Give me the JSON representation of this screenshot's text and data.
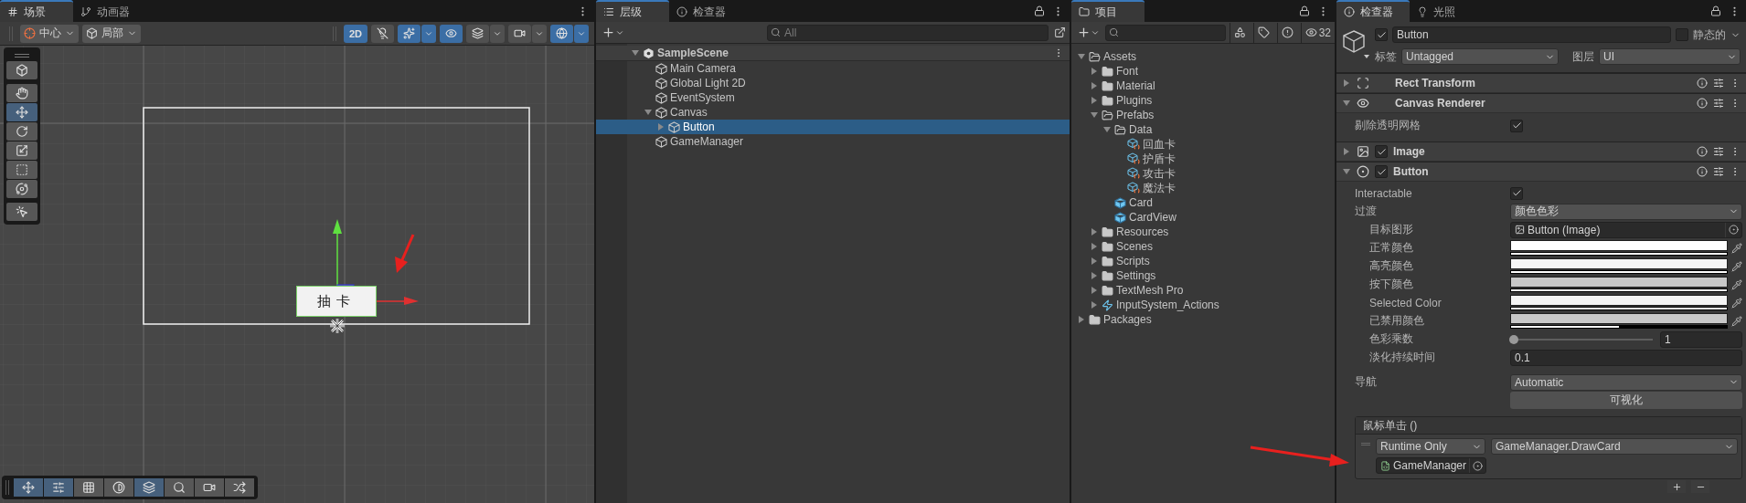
{
  "scene_panel": {
    "tabs": [
      {
        "label": "场景",
        "kind": "scene",
        "selected": true
      },
      {
        "label": "动画器",
        "kind": "animator",
        "selected": false
      }
    ],
    "toolbar": {
      "pivot": "中心",
      "space": "局部",
      "toggles": [
        {
          "kind": "mode",
          "label": "2D",
          "on": true
        },
        {
          "kind": "light",
          "on": false
        },
        {
          "kind": "fx",
          "on": true
        },
        {
          "kind": "visibility",
          "on": true
        },
        {
          "kind": "layers",
          "on": false
        },
        {
          "kind": "camera",
          "on": false
        },
        {
          "kind": "gizmos",
          "on": true
        }
      ]
    },
    "tools": [
      {
        "kind": "view",
        "selected": false
      },
      {
        "kind": "hand",
        "selected": false
      },
      {
        "kind": "move",
        "selected": true
      },
      {
        "kind": "rotate",
        "selected": false
      },
      {
        "kind": "scale",
        "selected": false
      },
      {
        "kind": "rect",
        "selected": false
      },
      {
        "kind": "transform",
        "selected": false
      },
      {
        "kind": "add",
        "selected": false
      }
    ],
    "game_button_label": "抽卡",
    "overlay_tools": [
      {
        "kind": "move",
        "on": true
      },
      {
        "kind": "snap",
        "on": true
      },
      {
        "kind": "grid",
        "on": false
      },
      {
        "kind": "shading",
        "on": false
      },
      {
        "kind": "layers",
        "on": true
      },
      {
        "kind": "search",
        "on": false
      },
      {
        "kind": "camera",
        "on": false
      },
      {
        "kind": "shuffle",
        "on": false
      }
    ]
  },
  "hierarchy_panel": {
    "tabs": [
      {
        "label": "层级",
        "kind": "hierarchy",
        "selected": true
      },
      {
        "label": "检查器",
        "kind": "info",
        "selected": false
      }
    ],
    "search": {
      "placeholder": "All"
    },
    "items": [
      {
        "label": "SampleScene",
        "kind": "scene",
        "expanded": true,
        "selected": false,
        "children": [
          {
            "label": "Main Camera",
            "kind": "object",
            "selected": false
          },
          {
            "label": "Global Light 2D",
            "kind": "object",
            "selected": false
          },
          {
            "label": "EventSystem",
            "kind": "object",
            "selected": false
          },
          {
            "label": "Canvas",
            "kind": "object",
            "expanded": true,
            "selected": false,
            "children": [
              {
                "label": "Button",
                "kind": "object",
                "expanded": false,
                "selected": true
              }
            ]
          },
          {
            "label": "GameManager",
            "kind": "object",
            "selected": false
          }
        ]
      }
    ]
  },
  "project_panel": {
    "tabs": [
      {
        "label": "项目",
        "kind": "folder",
        "selected": true
      }
    ],
    "count": "32",
    "items": [
      {
        "label": "Assets",
        "kind": "folder",
        "expanded": true,
        "selected": false,
        "children": [
          {
            "label": "Font",
            "kind": "folder",
            "expanded": false,
            "selected": false
          },
          {
            "label": "Material",
            "kind": "folder",
            "expanded": false,
            "selected": false
          },
          {
            "label": "Plugins",
            "kind": "folder",
            "expanded": false,
            "selected": false
          },
          {
            "label": "Prefabs",
            "kind": "folder",
            "expanded": true,
            "selected": false,
            "children": [
              {
                "label": "Data",
                "kind": "folder",
                "expanded": true,
                "selected": false,
                "children": [
                  {
                    "label": "回血卡",
                    "kind": "data",
                    "selected": false
                  },
                  {
                    "label": "护盾卡",
                    "kind": "data",
                    "selected": false
                  },
                  {
                    "label": "攻击卡",
                    "kind": "data",
                    "selected": false
                  },
                  {
                    "label": "魔法卡",
                    "kind": "data",
                    "selected": false
                  }
                ]
              },
              {
                "label": "Card",
                "kind": "prefab",
                "selected": false
              },
              {
                "label": "CardView",
                "kind": "prefab",
                "selected": false
              }
            ]
          },
          {
            "label": "Resources",
            "kind": "folder",
            "expanded": false,
            "selected": false
          },
          {
            "label": "Scenes",
            "kind": "folder",
            "expanded": false,
            "selected": false
          },
          {
            "label": "Scripts",
            "kind": "folder",
            "expanded": false,
            "selected": false
          },
          {
            "label": "Settings",
            "kind": "folder",
            "expanded": false,
            "selected": false
          },
          {
            "label": "TextMesh Pro",
            "kind": "folder",
            "expanded": false,
            "selected": false
          },
          {
            "label": "InputSystem_Actions",
            "kind": "actions",
            "expanded": false,
            "selected": false
          }
        ]
      },
      {
        "label": "Packages",
        "kind": "folder",
        "expanded": false,
        "selected": false
      }
    ]
  },
  "inspector_panel": {
    "tabs": [
      {
        "label": "检查器",
        "kind": "info",
        "selected": true
      },
      {
        "label": "光照",
        "kind": "light",
        "selected": false
      }
    ],
    "object": {
      "active": true,
      "name": "Button",
      "static": false,
      "static_label": "静态的",
      "tag_label": "标签",
      "tag": "Untagged",
      "layer_label": "图层",
      "layer": "UI"
    },
    "components": [
      {
        "name": "Rect Transform",
        "kind": "rect",
        "expanded": false
      },
      {
        "name": "Canvas Renderer",
        "kind": "renderer",
        "expanded": true,
        "fields": [
          {
            "kind": "checkbox",
            "label": "剔除透明网格",
            "checked": true
          }
        ]
      },
      {
        "name": "Image",
        "kind": "image",
        "expanded": false,
        "enabled": true
      },
      {
        "name": "Button",
        "kind": "button",
        "expanded": true,
        "enabled": true,
        "fields": [
          {
            "kind": "checkbox",
            "label": "Interactable",
            "checked": true
          },
          {
            "kind": "dropdown",
            "label": "过渡",
            "value": "颜色色彩",
            "children": [
              {
                "kind": "object",
                "label": "目标图形",
                "value": "Button (Image)"
              },
              {
                "kind": "color",
                "label": "正常颜色",
                "color": "#ffffff",
                "level": 1
              },
              {
                "kind": "color",
                "label": "高亮颜色",
                "color": "#f5f5f5",
                "level": 1
              },
              {
                "kind": "color",
                "label": "按下颜色",
                "color": "#c8c8c8",
                "level": 1
              },
              {
                "kind": "color",
                "label": "Selected Color",
                "color": "#f5f5f5",
                "level": 1
              },
              {
                "kind": "color",
                "label": "已禁用颜色",
                "color": "#c8c8c8",
                "level": 0.5
              },
              {
                "kind": "slider",
                "label": "色彩乘数",
                "level": 0,
                "value": "1"
              },
              {
                "kind": "number",
                "label": "淡化持续时间",
                "value": "0.1"
              }
            ]
          }
        ],
        "navigation": {
          "label": "导航",
          "value": "Automatic"
        },
        "visualize": "可视化",
        "event": {
          "title": "鼠标单击 ()",
          "mode": "Runtime Only",
          "function": "GameManager.DrawCard",
          "target": "GameManager"
        }
      }
    ]
  }
}
